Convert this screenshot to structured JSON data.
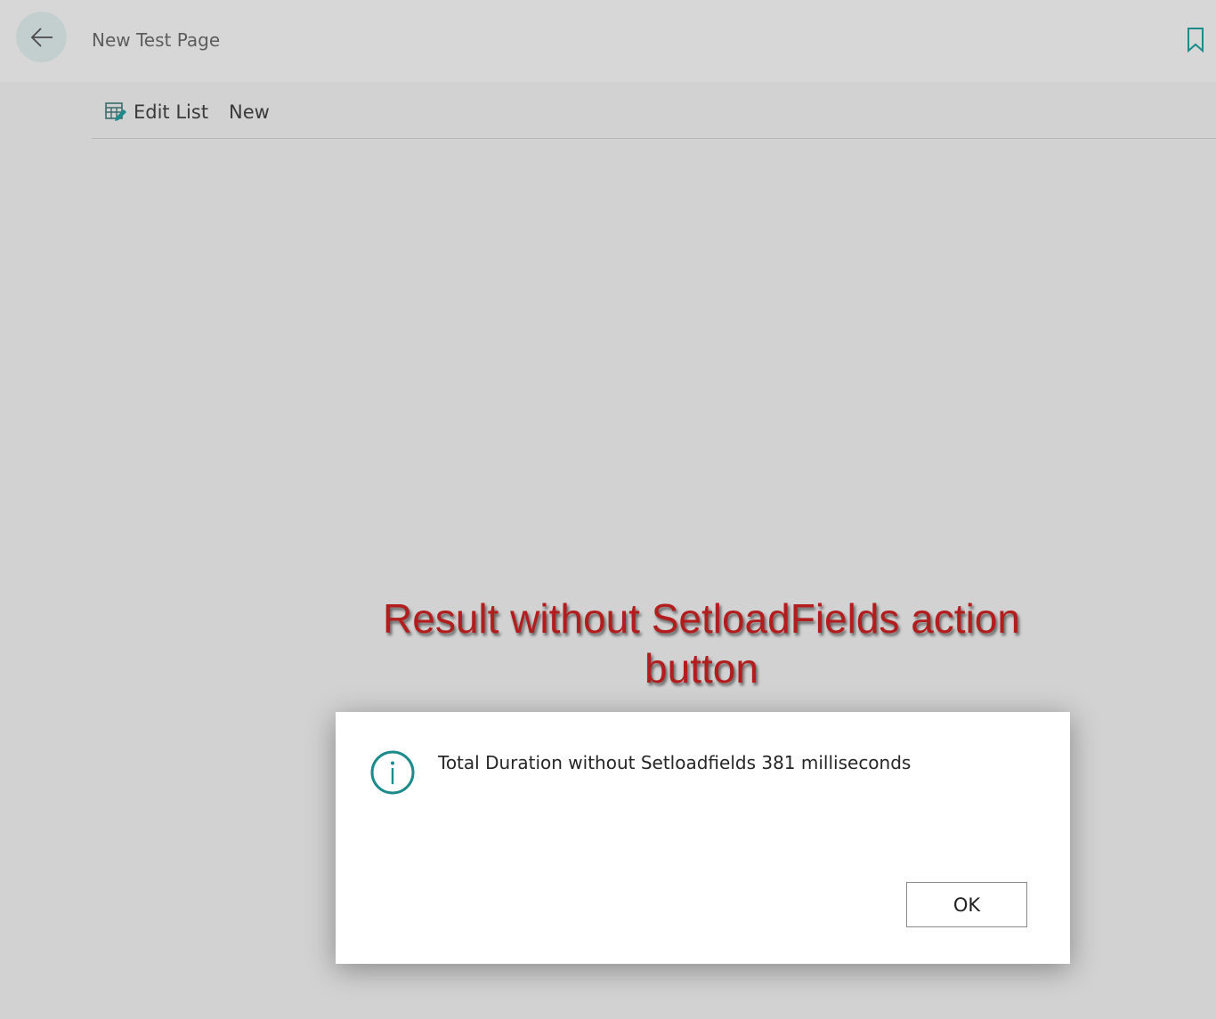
{
  "header": {
    "page_title": "New Test Page",
    "back_icon": "arrow-left-icon",
    "bookmark_icon": "bookmark-icon"
  },
  "action_bar": {
    "edit_list_label": "Edit List",
    "edit_list_icon": "edit-list-icon",
    "new_label": "New"
  },
  "annotation": {
    "text": "Result without SetloadFields action button",
    "color": "#b41d1d"
  },
  "dialog": {
    "icon": "info-icon",
    "message": "Total Duration without Setloadfields 381 milliseconds",
    "ok_label": "OK"
  },
  "colors": {
    "accent": "#1d8b8b",
    "overlay": "#d2d2d2"
  }
}
